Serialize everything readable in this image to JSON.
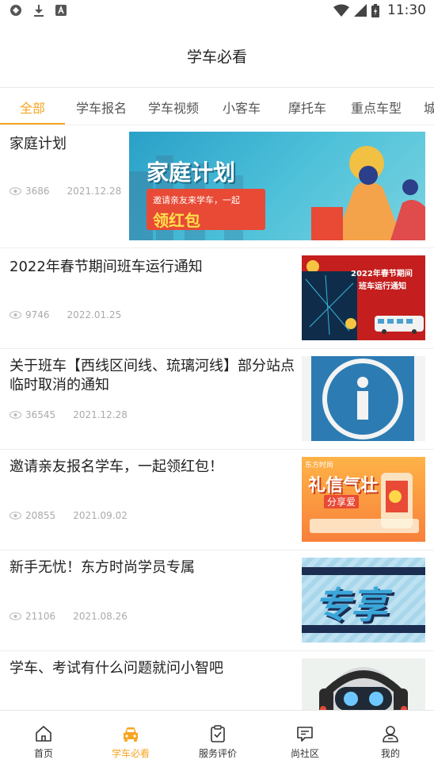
{
  "statusbar": {
    "time": "11:30"
  },
  "header": {
    "title": "学车必看"
  },
  "tabs": [
    {
      "label": "全部",
      "active": true
    },
    {
      "label": "学车报名"
    },
    {
      "label": "学车视频"
    },
    {
      "label": "小客车"
    },
    {
      "label": "摩托车"
    },
    {
      "label": "重点车型"
    },
    {
      "label": "城"
    }
  ],
  "articles": [
    {
      "title": "家庭计划",
      "views": "3686",
      "date": "2021.12.28",
      "thumb": {
        "headline": "家庭计划",
        "sub": "邀请亲友来学车，一起",
        "badge": "领红包"
      }
    },
    {
      "title": "2022年春节期间班车运行通知",
      "views": "9746",
      "date": "2022.01.25",
      "thumb": {
        "headline": "2022年春节期间",
        "sub": "班车运行通知"
      }
    },
    {
      "title": "关于班车【西线区间线、琉璃河线】部分站点临时取消的通知",
      "views": "36545",
      "date": "2021.12.28",
      "thumb": {
        "glyph": "i"
      }
    },
    {
      "title": "邀请亲友报名学车，一起领红包！",
      "views": "20855",
      "date": "2021.09.02",
      "thumb": {
        "brand": "东方时尚",
        "headline": "礼信气壮",
        "sub": "分享爱"
      }
    },
    {
      "title": "新手无忧！东方时尚学员专属",
      "views": "21106",
      "date": "2021.08.26",
      "thumb": {
        "headline": "专享"
      }
    },
    {
      "title": "学车、考试有什么问题就问小智吧",
      "views": "",
      "date": "",
      "thumb": {}
    }
  ],
  "bottomnav": [
    {
      "label": "首页",
      "icon": "home-icon"
    },
    {
      "label": "学车必看",
      "icon": "car-icon",
      "active": true
    },
    {
      "label": "服务评价",
      "icon": "clipboard-check-icon"
    },
    {
      "label": "尚社区",
      "icon": "chat-icon"
    },
    {
      "label": "我的",
      "icon": "user-icon"
    }
  ],
  "colors": {
    "accent": "#f5a623",
    "text": "#222222",
    "meta": "#aaaaaa"
  }
}
